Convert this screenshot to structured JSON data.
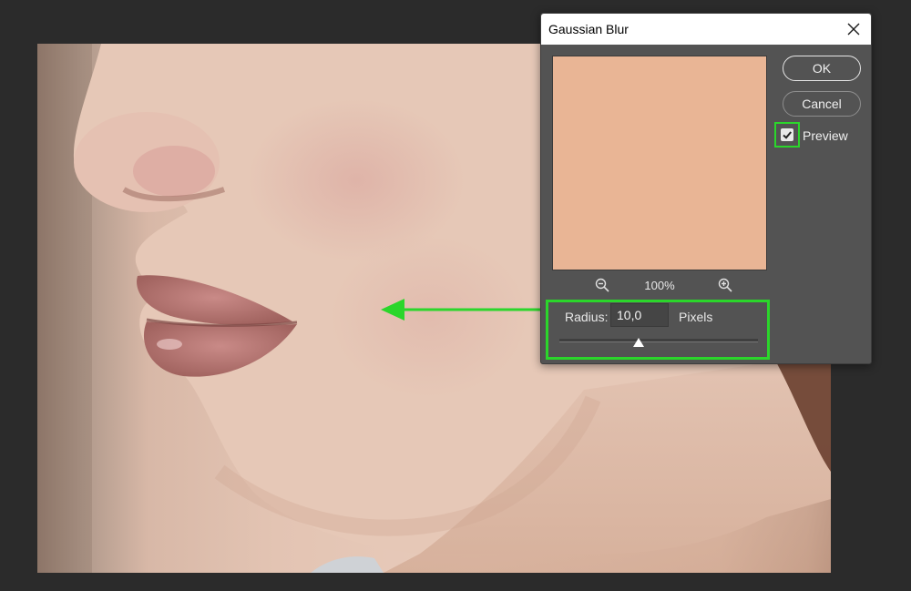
{
  "dialog": {
    "title": "Gaussian Blur",
    "ok_label": "OK",
    "cancel_label": "Cancel",
    "preview_label": "Preview",
    "preview_checked": true,
    "zoom_level": "100%",
    "radius_label": "Radius:",
    "radius_value": "10,0",
    "radius_unit": "Pixels",
    "radius_slider_fraction": 0.4,
    "icons": {
      "close": "close-icon",
      "zoom_out": "zoom-out-icon",
      "zoom_in": "zoom-in-icon",
      "check": "checkmark-icon"
    }
  },
  "colors": {
    "dialog_bg": "#535353",
    "app_bg": "#2b2b2b",
    "highlight_green": "#2bd62b",
    "preview_swatch": "#e9b595"
  }
}
